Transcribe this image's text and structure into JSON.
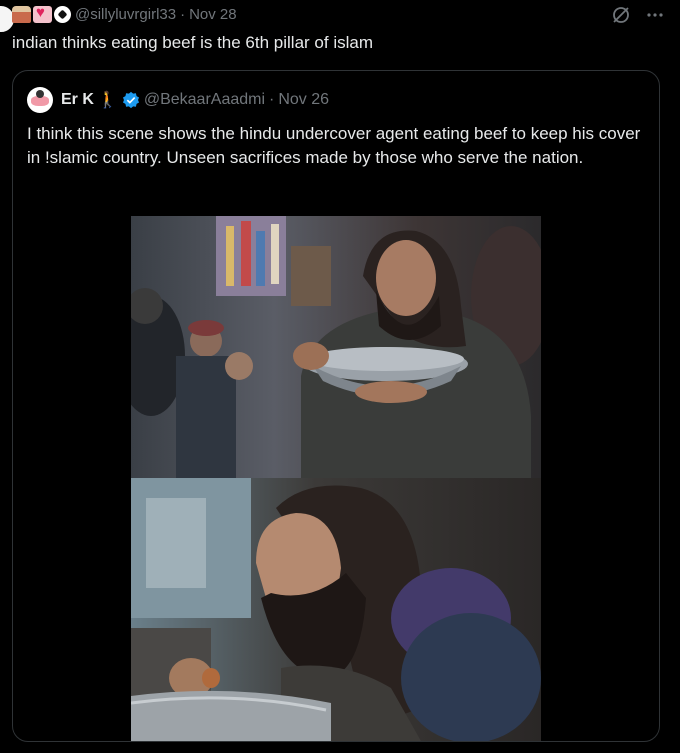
{
  "tweet": {
    "author_handle": "@sillyluvrgirl33",
    "separator": "·",
    "date": "Nov 28",
    "text": "indian thinks eating beef is the 6th pillar of islam",
    "emoji_icons": [
      "car-emoji-icon",
      "heart-emoji-icon",
      "soccer-ball-emoji-icon"
    ]
  },
  "quote": {
    "display_name": "Er K",
    "handle": "@BekaarAaadmi",
    "separator": "·",
    "date": "Nov 26",
    "text": "I think this scene shows the hindu undercover agent eating beef to keep his cover in !slamic country. Unseen sacrifices made by those who serve the nation.",
    "verified": true
  },
  "colors": {
    "background": "#000000",
    "text_primary": "#e7e9ea",
    "text_secondary": "#71767b",
    "card_border": "#2f3336",
    "verified_blue": "#1d9bf0"
  }
}
